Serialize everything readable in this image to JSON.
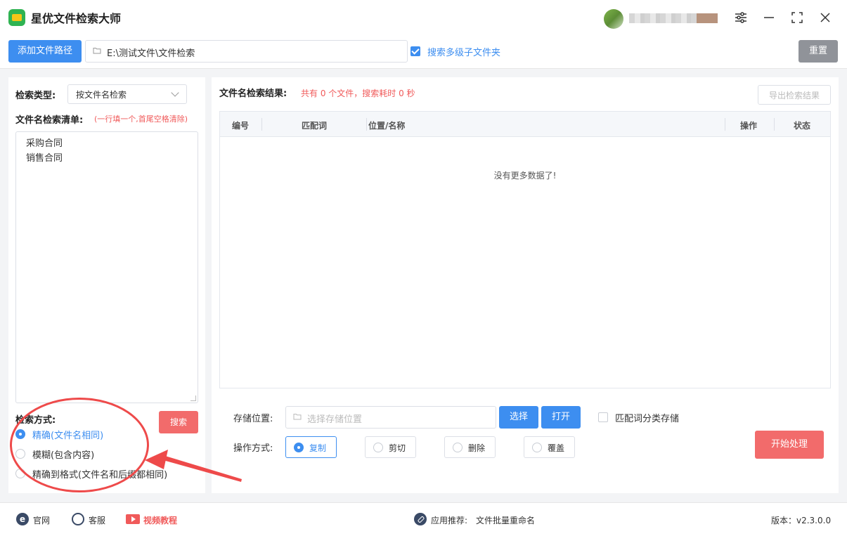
{
  "app": {
    "title": "星优文件检索大师"
  },
  "toolbar": {
    "add_path_label": "添加文件路径",
    "path_value": "E:\\测试文件\\文件检索",
    "subfolder_label": "搜索多级子文件夹",
    "subfolder_checked": true,
    "reset_label": "重置"
  },
  "left": {
    "search_type_label": "检索类型:",
    "search_type_value": "按文件名检索",
    "list_label": "文件名检索清单:",
    "list_hint": "(一行填一个,首尾空格清除)",
    "list_items": [
      "采购合同",
      "销售合同"
    ],
    "method_label": "检索方式:",
    "search_button": "搜索",
    "methods": [
      {
        "label": "精确(文件名相同)",
        "selected": true
      },
      {
        "label": "模糊(包含内容)",
        "selected": false
      },
      {
        "label": "精确到格式(文件名和后缀都相同)",
        "selected": false
      }
    ]
  },
  "right": {
    "result_title": "文件名检索结果:",
    "result_stat": "共有 0 个文件，搜索耗时 0 秒",
    "export_label": "导出检索结果",
    "columns": [
      "编号",
      "匹配词",
      "位置/名称",
      "操作",
      "状态"
    ],
    "empty_message": "没有更多数据了!",
    "storage_label": "存储位置:",
    "storage_placeholder": "选择存储位置",
    "choose_label": "选择",
    "open_label": "打开",
    "classify_label": "匹配词分类存储",
    "classify_checked": false,
    "op_label": "操作方式:",
    "operations": [
      {
        "label": "复制",
        "selected": true
      },
      {
        "label": "剪切",
        "selected": false
      },
      {
        "label": "删除",
        "selected": false
      },
      {
        "label": "覆盖",
        "selected": false
      }
    ],
    "start_label": "开始处理"
  },
  "footer": {
    "official_site": "官网",
    "customer_service": "客服",
    "video_tutorial": "视频教程",
    "recommend_label": "应用推荐:",
    "recommend_app": "文件批量重命名",
    "version": "版本：v2.3.0.0"
  },
  "colors": {
    "primary": "#3d8ef0",
    "danger": "#f26b6b",
    "app_logo": "#2fb352"
  }
}
